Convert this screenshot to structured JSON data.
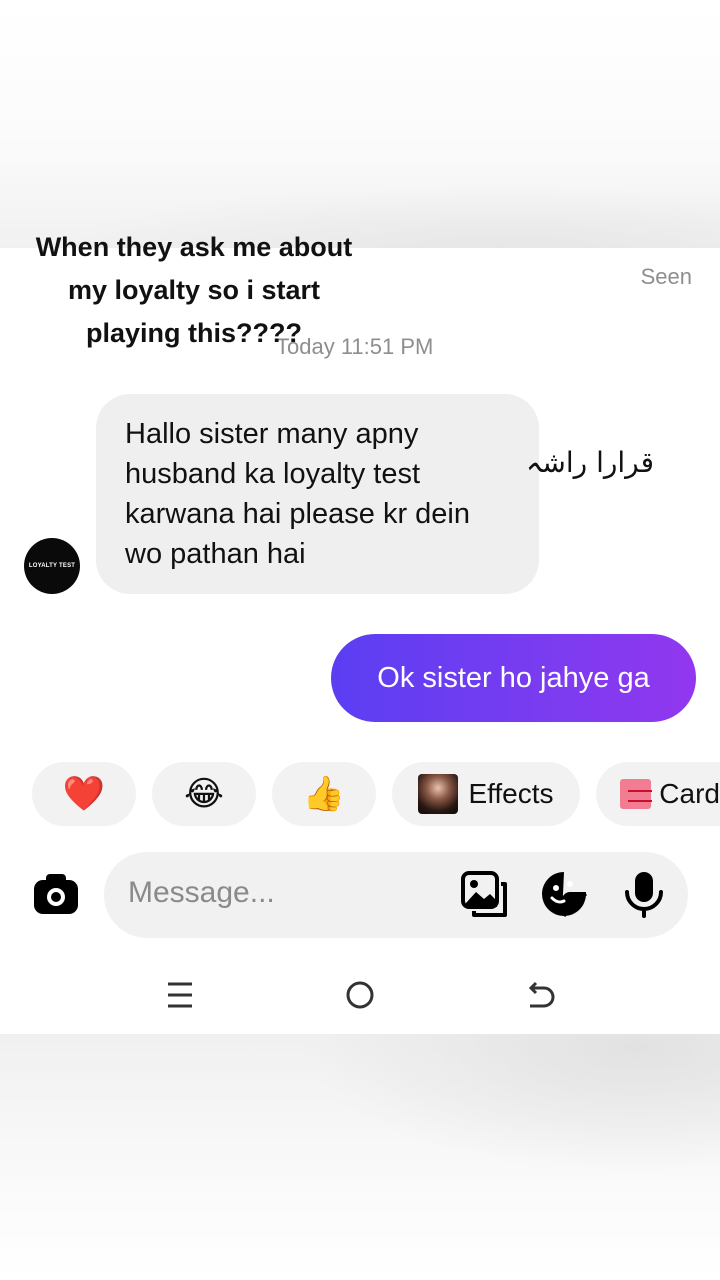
{
  "caption": {
    "line1": "When they ask me about",
    "line2": "my loyalty so i start",
    "line3": "playing this????"
  },
  "status": {
    "seen": "Seen",
    "timestamp": "Today 11:51 PM"
  },
  "avatar": {
    "label": "LOYALTY TEST"
  },
  "incoming": {
    "line1": "Hallo sister many apny",
    "line2": "husband ka loyalty test",
    "line3": "karwana hai please kr dein",
    "line4": "wo pathan hai"
  },
  "side_text": "قرارا راشہ",
  "outgoing": {
    "text": "Ok sister ho jahye ga"
  },
  "quick_reactions": {
    "heart": "❤️",
    "laugh": "😂",
    "thumbs": "👍",
    "effects_label": "Effects",
    "cards_label": "Card"
  },
  "composer": {
    "placeholder": "Message..."
  },
  "icons": {
    "camera": "camera-icon",
    "gallery": "gallery-icon",
    "sticker": "sticker-icon",
    "mic": "microphone-icon",
    "menu": "menu-icon",
    "home": "home-icon",
    "back": "back-icon"
  },
  "colors": {
    "outgoing_start": "#5b3ef2",
    "outgoing_end": "#9137ef",
    "incoming_bg": "#efefef"
  }
}
